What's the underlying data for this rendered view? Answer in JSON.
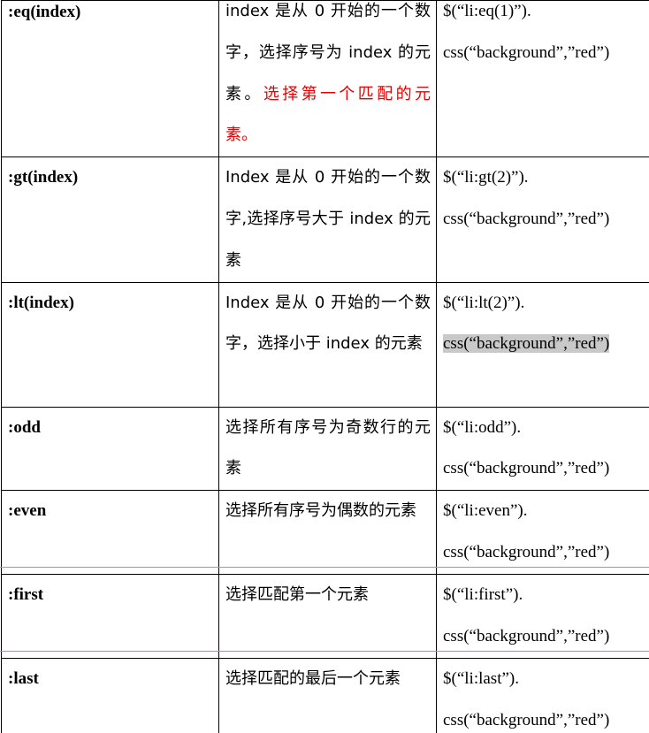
{
  "rows": [
    {
      "selector": ":eq(index)",
      "desc_plain": "index 是从 0 开始的一个数字，选择序号为 index 的元素。",
      "desc_red": "选择第一个匹配的元素。",
      "code_line1": "$(“li:eq(1)”).",
      "code_line2": "css(“background”,”red”)"
    },
    {
      "selector": ":gt(index)",
      "desc_plain": "Index  是从 0 开始的一个数字,选择序号大于 index 的元素",
      "desc_red": "",
      "code_line1": "$(“li:gt(2)”).",
      "code_line2": "css(“background”,”red”)"
    },
    {
      "selector": ":lt(index)",
      "desc_plain": "Index 是从 0 开始的一个数字，选择小于 index  的元素",
      "desc_red": "",
      "code_line1": "$(“li:lt(2)”).",
      "code_line2": "css(“background”,”red”)"
    },
    {
      "selector": ":odd",
      "desc_plain": "选择所有序号为奇数行的元素",
      "desc_red": "",
      "code_line1": "$(“li:odd”).",
      "code_line2": "css(“background”,”red”)"
    },
    {
      "selector": ":even",
      "desc_plain": "选择所有序号为偶数的元素",
      "desc_red": "",
      "code_line1": "$(“li:even”).",
      "code_line2": "css(“background”,”red”)"
    },
    {
      "selector": ":first",
      "desc_plain": "选择匹配第一个元素",
      "desc_red": "",
      "code_line1": "$(“li:first”).",
      "code_line2": "css(“background”,”red”)"
    },
    {
      "selector": ":last",
      "desc_plain": "选择匹配的最后一个元素",
      "desc_red": "",
      "code_line1": "$(“li:last”).",
      "code_line2": "css(“background”,”red”)"
    }
  ],
  "colors": {
    "red_text": "#e60000",
    "highlight": "#c9c9c9",
    "border": "#000000"
  }
}
